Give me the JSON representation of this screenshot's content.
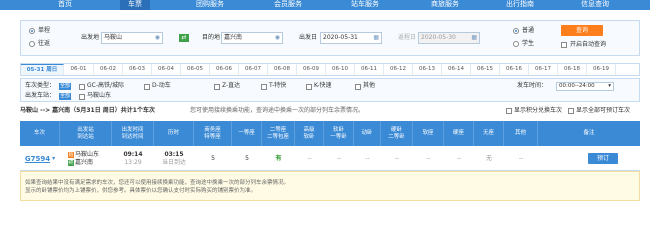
{
  "nav": {
    "items": [
      "首页",
      "车票",
      "团购服务",
      "会员服务",
      "站车服务",
      "商旅服务",
      "出行指南",
      "信息查询"
    ],
    "active_index": 1
  },
  "search": {
    "trip_type": {
      "one_way": "单程",
      "round_trip": "往返",
      "selected": "one_way"
    },
    "from_label": "出发地",
    "from_value": "马鞍山",
    "to_label": "目的地",
    "to_value": "嘉兴南",
    "depart_label": "出发日",
    "depart_value": "2020-05-31",
    "return_label": "返程日",
    "return_value": "2020-05-30",
    "passenger": {
      "normal": "普通",
      "student": "学生",
      "selected": "normal"
    },
    "query_button": "查询",
    "auto_query_label": "开启自动查询",
    "swap_icon": "⇄"
  },
  "dates": [
    "05-31 周日",
    "06-01",
    "06-02",
    "06-03",
    "06-04",
    "06-05",
    "06-06",
    "06-07",
    "06-08",
    "06-09",
    "06-10",
    "06-11",
    "06-12",
    "06-13",
    "06-14",
    "06-15",
    "06-16",
    "06-17",
    "06-18",
    "06-19"
  ],
  "filter": {
    "train_type_label": "车次类型：",
    "train_type_all": "全部",
    "train_types": [
      "GC-高铁/城际",
      "D-动车",
      "Z-直达",
      "T-特快",
      "K-快速",
      "其他"
    ],
    "depart_station_label": "出发车站：",
    "depart_station_all": "全部",
    "depart_station": "马鞍山东",
    "time_label": "发车时间：",
    "time_value": "00:00--24:00"
  },
  "result": {
    "route": "马鞍山 --> 嘉兴南（5月31日 周日）共计1个车次",
    "hint": "您可使用接续换乘功能，查询途中换乘一次的部分列车余票情况。",
    "show_points": "显示积分兑换车次",
    "show_all": "显示全部可预订车次"
  },
  "table": {
    "headers": [
      "车次",
      "出发站\n到达站",
      "出发时间\n到达时间",
      "历时",
      "商务座\n特等座",
      "一等座",
      "二等座\n二等包座",
      "高级\n软卧",
      "软卧\n一等卧",
      "动卧",
      "硬卧\n二等卧",
      "软座",
      "硬座",
      "无座",
      "其他",
      "备注"
    ],
    "row": {
      "train_no": "G7594",
      "from_station": "马鞍山东",
      "to_station": "嘉兴南",
      "depart_time": "09:14",
      "arrive_time": "13:29",
      "duration": "03:15",
      "arrival_day": "当日到达",
      "business": "5",
      "first": "5",
      "second": "有",
      "adv_soft": "--",
      "soft": "--",
      "dong": "--",
      "hard_sleeper": "--",
      "soft_seat": "--",
      "hard_seat": "--",
      "no_seat": "无",
      "other": "--",
      "book": "预订"
    }
  },
  "notice": [
    "如果查询结果中没有满足需求的车次，您还可以使用接续换乘功能，查询途中换乘一次的部分列车余票情况。",
    "显示的卧铺票价均为上铺票价，供您参考。具体票价以您确认支付时实际购买的铺别票价为准。"
  ],
  "colors": {
    "nav": "#3a8ad6",
    "query": "#ff7e1c",
    "accent": "#3a8ad6",
    "available": "#2a9b2a"
  }
}
